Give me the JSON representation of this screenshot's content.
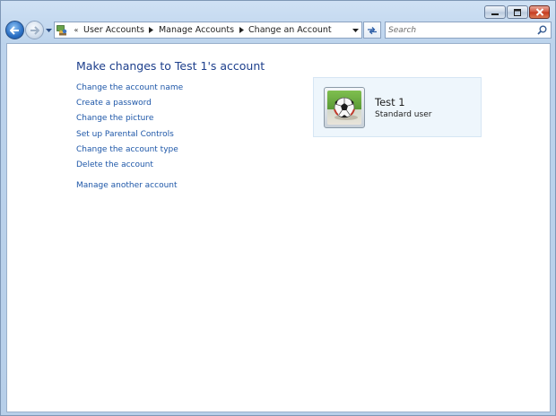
{
  "window": {
    "caption_buttons": [
      "minimize",
      "maximize",
      "close"
    ]
  },
  "navbar": {
    "back_icon": "back-arrow-icon",
    "forward_icon": "forward-arrow-icon",
    "address": {
      "overflow_chevron": "«",
      "breadcrumbs": [
        "User Accounts",
        "Manage Accounts",
        "Change an Account"
      ]
    },
    "search": {
      "placeholder": "Search"
    }
  },
  "main": {
    "title": "Make changes to Test 1's account",
    "tasks": [
      "Change the account name",
      "Create a password",
      "Change the picture",
      "Set up Parental Controls",
      "Change the account type",
      "Delete the account"
    ],
    "secondary_task": "Manage another account",
    "account": {
      "name": "Test 1",
      "type": "Standard user",
      "picture": "soccer-ball-picture"
    }
  },
  "colors": {
    "link": "#1e57a8",
    "title": "#1d3f8c",
    "card_background": "#eef6fc",
    "chrome": "#bcd3ec"
  }
}
